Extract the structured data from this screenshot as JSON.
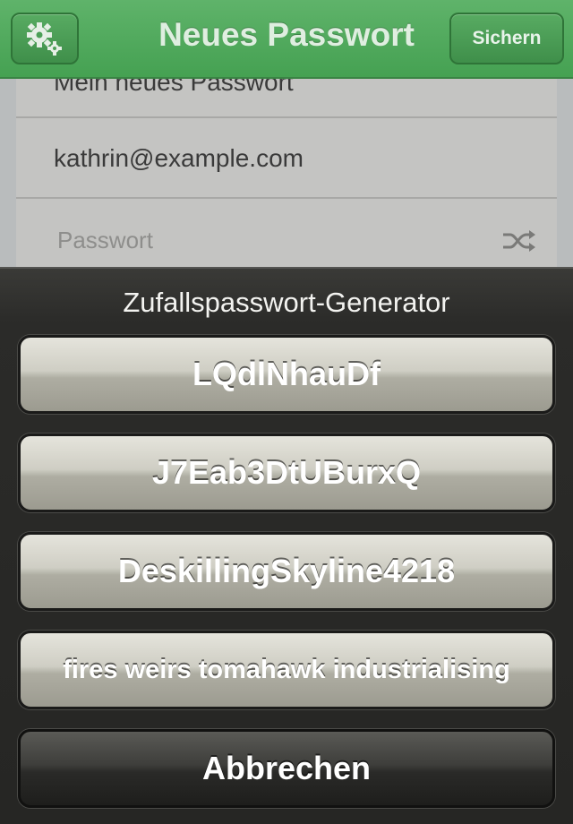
{
  "navbar": {
    "title": "Neues Passwort",
    "save_label": "Sichern",
    "settings_icon": "gear-icon"
  },
  "form": {
    "name_value": "Mein neues Passwort",
    "email_value": "kathrin@example.com",
    "password_placeholder": "Passwort",
    "shuffle_icon": "shuffle-icon"
  },
  "sheet": {
    "title": "Zufallspasswort-Generator",
    "options": [
      "LQdlNhauDf",
      "J7Eab3DtUBurxQ",
      "DeskillingSkyline4218",
      "fires weirs tomahawk industrialising"
    ],
    "cancel_label": "Abbrechen"
  },
  "colors": {
    "nav_green": "#4fa95c",
    "sheet_dark": "#2b2b29",
    "button_light": "#cfcec4"
  }
}
